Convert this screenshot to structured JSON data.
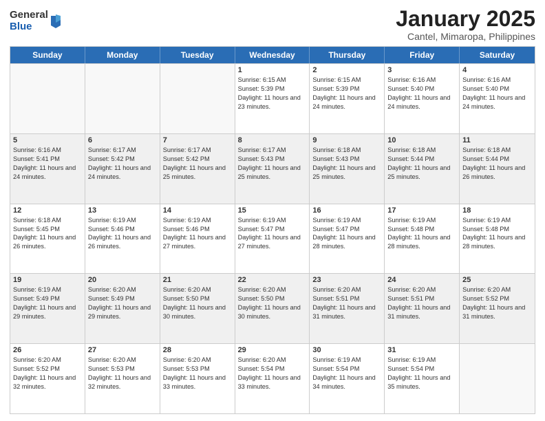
{
  "logo": {
    "general": "General",
    "blue": "Blue"
  },
  "title": {
    "month": "January 2025",
    "location": "Cantel, Mimaropa, Philippines"
  },
  "weekdays": [
    "Sunday",
    "Monday",
    "Tuesday",
    "Wednesday",
    "Thursday",
    "Friday",
    "Saturday"
  ],
  "weeks": [
    [
      {
        "day": "",
        "empty": true
      },
      {
        "day": "",
        "empty": true
      },
      {
        "day": "",
        "empty": true
      },
      {
        "day": "1",
        "sunrise": "6:15 AM",
        "sunset": "5:39 PM",
        "daylight": "11 hours and 23 minutes."
      },
      {
        "day": "2",
        "sunrise": "6:15 AM",
        "sunset": "5:39 PM",
        "daylight": "11 hours and 24 minutes."
      },
      {
        "day": "3",
        "sunrise": "6:16 AM",
        "sunset": "5:40 PM",
        "daylight": "11 hours and 24 minutes."
      },
      {
        "day": "4",
        "sunrise": "6:16 AM",
        "sunset": "5:40 PM",
        "daylight": "11 hours and 24 minutes."
      }
    ],
    [
      {
        "day": "5",
        "sunrise": "6:16 AM",
        "sunset": "5:41 PM",
        "daylight": "11 hours and 24 minutes."
      },
      {
        "day": "6",
        "sunrise": "6:17 AM",
        "sunset": "5:42 PM",
        "daylight": "11 hours and 24 minutes."
      },
      {
        "day": "7",
        "sunrise": "6:17 AM",
        "sunset": "5:42 PM",
        "daylight": "11 hours and 25 minutes."
      },
      {
        "day": "8",
        "sunrise": "6:17 AM",
        "sunset": "5:43 PM",
        "daylight": "11 hours and 25 minutes."
      },
      {
        "day": "9",
        "sunrise": "6:18 AM",
        "sunset": "5:43 PM",
        "daylight": "11 hours and 25 minutes."
      },
      {
        "day": "10",
        "sunrise": "6:18 AM",
        "sunset": "5:44 PM",
        "daylight": "11 hours and 25 minutes."
      },
      {
        "day": "11",
        "sunrise": "6:18 AM",
        "sunset": "5:44 PM",
        "daylight": "11 hours and 26 minutes."
      }
    ],
    [
      {
        "day": "12",
        "sunrise": "6:18 AM",
        "sunset": "5:45 PM",
        "daylight": "11 hours and 26 minutes."
      },
      {
        "day": "13",
        "sunrise": "6:19 AM",
        "sunset": "5:46 PM",
        "daylight": "11 hours and 26 minutes."
      },
      {
        "day": "14",
        "sunrise": "6:19 AM",
        "sunset": "5:46 PM",
        "daylight": "11 hours and 27 minutes."
      },
      {
        "day": "15",
        "sunrise": "6:19 AM",
        "sunset": "5:47 PM",
        "daylight": "11 hours and 27 minutes."
      },
      {
        "day": "16",
        "sunrise": "6:19 AM",
        "sunset": "5:47 PM",
        "daylight": "11 hours and 28 minutes."
      },
      {
        "day": "17",
        "sunrise": "6:19 AM",
        "sunset": "5:48 PM",
        "daylight": "11 hours and 28 minutes."
      },
      {
        "day": "18",
        "sunrise": "6:19 AM",
        "sunset": "5:48 PM",
        "daylight": "11 hours and 28 minutes."
      }
    ],
    [
      {
        "day": "19",
        "sunrise": "6:19 AM",
        "sunset": "5:49 PM",
        "daylight": "11 hours and 29 minutes."
      },
      {
        "day": "20",
        "sunrise": "6:20 AM",
        "sunset": "5:49 PM",
        "daylight": "11 hours and 29 minutes."
      },
      {
        "day": "21",
        "sunrise": "6:20 AM",
        "sunset": "5:50 PM",
        "daylight": "11 hours and 30 minutes."
      },
      {
        "day": "22",
        "sunrise": "6:20 AM",
        "sunset": "5:50 PM",
        "daylight": "11 hours and 30 minutes."
      },
      {
        "day": "23",
        "sunrise": "6:20 AM",
        "sunset": "5:51 PM",
        "daylight": "11 hours and 31 minutes."
      },
      {
        "day": "24",
        "sunrise": "6:20 AM",
        "sunset": "5:51 PM",
        "daylight": "11 hours and 31 minutes."
      },
      {
        "day": "25",
        "sunrise": "6:20 AM",
        "sunset": "5:52 PM",
        "daylight": "11 hours and 31 minutes."
      }
    ],
    [
      {
        "day": "26",
        "sunrise": "6:20 AM",
        "sunset": "5:52 PM",
        "daylight": "11 hours and 32 minutes."
      },
      {
        "day": "27",
        "sunrise": "6:20 AM",
        "sunset": "5:53 PM",
        "daylight": "11 hours and 32 minutes."
      },
      {
        "day": "28",
        "sunrise": "6:20 AM",
        "sunset": "5:53 PM",
        "daylight": "11 hours and 33 minutes."
      },
      {
        "day": "29",
        "sunrise": "6:20 AM",
        "sunset": "5:54 PM",
        "daylight": "11 hours and 33 minutes."
      },
      {
        "day": "30",
        "sunrise": "6:19 AM",
        "sunset": "5:54 PM",
        "daylight": "11 hours and 34 minutes."
      },
      {
        "day": "31",
        "sunrise": "6:19 AM",
        "sunset": "5:54 PM",
        "daylight": "11 hours and 35 minutes."
      },
      {
        "day": "",
        "empty": true
      }
    ]
  ]
}
